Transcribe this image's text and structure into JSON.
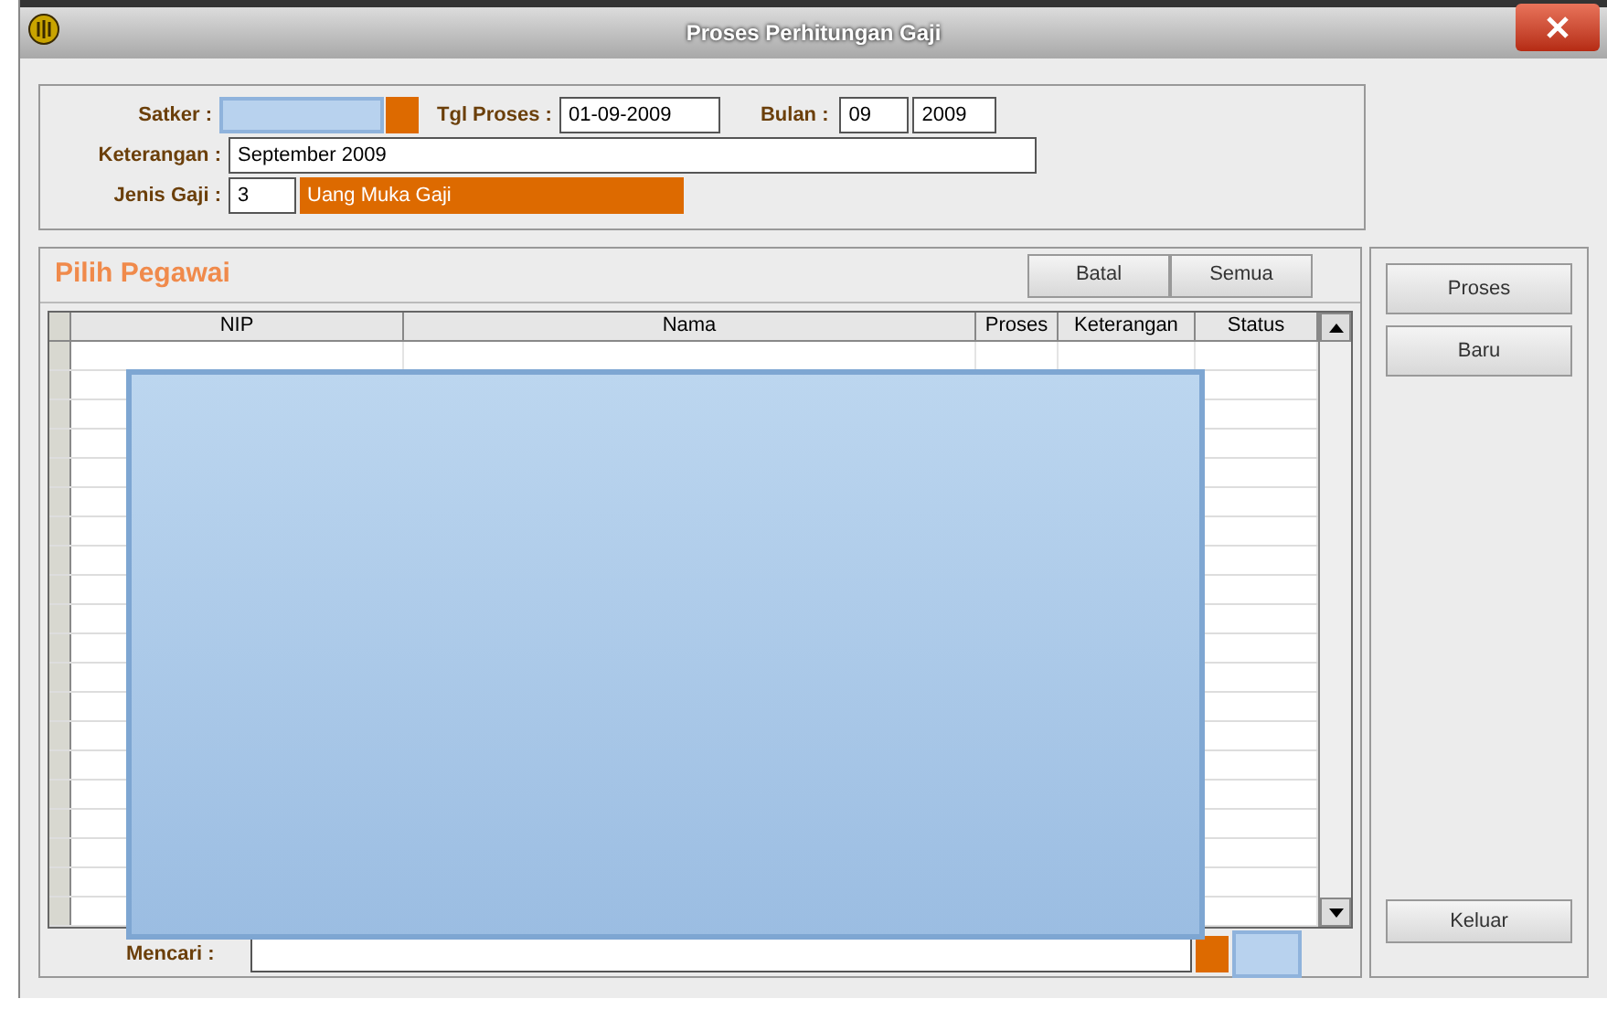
{
  "window": {
    "title": "Proses Perhitungan Gaji"
  },
  "form": {
    "satker_label": "Satker :",
    "tgl_label": "Tgl Proses :",
    "tgl_value": "01-09-2009",
    "bulan_label": "Bulan :",
    "bulan_value": "09",
    "tahun_value": "2009",
    "keterangan_label": "Keterangan :",
    "keterangan_value": "September 2009",
    "jenis_label": "Jenis Gaji :",
    "jenis_code": "3",
    "jenis_name": "Uang Muka Gaji"
  },
  "pegawai": {
    "title": "Pilih Pegawai",
    "buttons": [
      "Batal",
      "Semua"
    ],
    "table": {
      "columns": [
        "NIP",
        "Nama",
        "Proses",
        "Keterangan",
        "Status"
      ]
    },
    "search_label": "Mencari :"
  },
  "side_buttons": [
    "Proses",
    "Baru"
  ],
  "exit_button": "Keluar"
}
